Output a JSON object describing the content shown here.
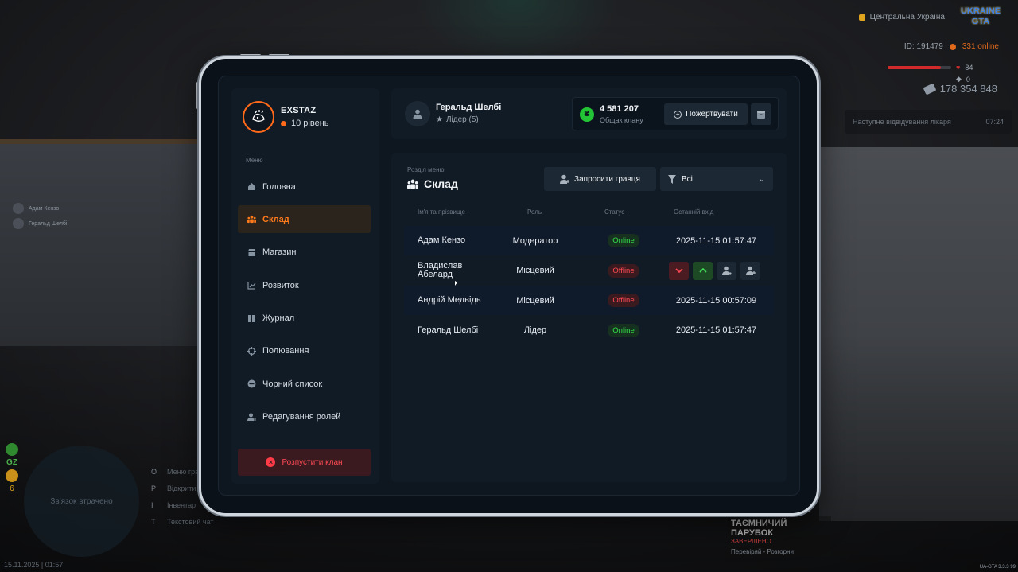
{
  "hud": {
    "region": "Центральна Україна",
    "logo_top": "UKRAINE",
    "logo_bottom": "GTA",
    "id_text": "ID: 191479",
    "online_text": "331 online",
    "health_value": "84",
    "armor_value": "0",
    "health_fraction": 0.84,
    "armor_fraction": 0.0,
    "money": "178 354 848",
    "notice_text": "Наступне відвідування лікаря",
    "notice_time": "07:24",
    "players": [
      {
        "name": "Адам Кензо"
      },
      {
        "name": "Геральд Шелбі"
      }
    ],
    "gz_label": "GZ",
    "six_label": "6",
    "minimap_text": "Зв'язок втрачено",
    "hints": [
      {
        "key": "O",
        "label": "Меню гравця"
      },
      {
        "key": "P",
        "label": "Відкрити ..."
      },
      {
        "key": "I",
        "label": "Інвентар"
      },
      {
        "key": "T",
        "label": "Текстовий чат"
      }
    ],
    "date": "15.11.2025 | 01:57",
    "version": "UA-GTA 3.3.3",
    "version_num": "99",
    "event_title": "ТАЄМНИЧИЙ ПАРУБОК",
    "event_badge": "ЗАВЕРШЕНО",
    "event_sub": "Перевіряй - Розгорни"
  },
  "clan": {
    "name": "EXSTAZ",
    "level": "10 рівень"
  },
  "menu": {
    "label": "Меню",
    "items": [
      {
        "label": "Головна",
        "icon": "home-icon"
      },
      {
        "label": "Склад",
        "icon": "members-icon"
      },
      {
        "label": "Магазин",
        "icon": "shop-icon"
      },
      {
        "label": "Розвиток",
        "icon": "chart-icon"
      },
      {
        "label": "Журнал",
        "icon": "book-icon"
      },
      {
        "label": "Полювання",
        "icon": "crosshair-icon"
      },
      {
        "label": "Чорний список",
        "icon": "block-icon"
      },
      {
        "label": "Редагування ролей",
        "icon": "user-edit-icon"
      }
    ],
    "active_index": 1,
    "disband_label": "Розпустити клан"
  },
  "user": {
    "name": "Геральд Шелбі",
    "role": "Лідер (5)"
  },
  "bank": {
    "amount": "4 581 207",
    "label": "Общак клану",
    "donate_label": "Пожертвувати"
  },
  "section": {
    "label": "Розділ меню",
    "title": "Склад",
    "invite_label": "Запросити гравця",
    "filter_value": "Всі"
  },
  "table": {
    "headers": {
      "name": "Ім'я та прізвище",
      "role": "Роль",
      "status": "Статус",
      "last": "Останній вхід"
    },
    "rows": [
      {
        "name": "Адам Кензо",
        "role": "Модератор",
        "status": "Online",
        "last": "2025-11-15 01:57:47"
      },
      {
        "name": "Владислав Абелард",
        "role": "Місцевий",
        "status": "Offline",
        "last": ""
      },
      {
        "name": "Андрій Медвідь",
        "role": "Місцевий",
        "status": "Offline",
        "last": "2025-11-15 00:57:09"
      },
      {
        "name": "Геральд Шелбі",
        "role": "Лідер",
        "status": "Online",
        "last": "2025-11-15 01:57:47"
      }
    ]
  },
  "colors": {
    "accent": "#ff7a1a",
    "online": "#35e04a",
    "offline": "#ff4a55",
    "bank_icon": "#22c435"
  }
}
